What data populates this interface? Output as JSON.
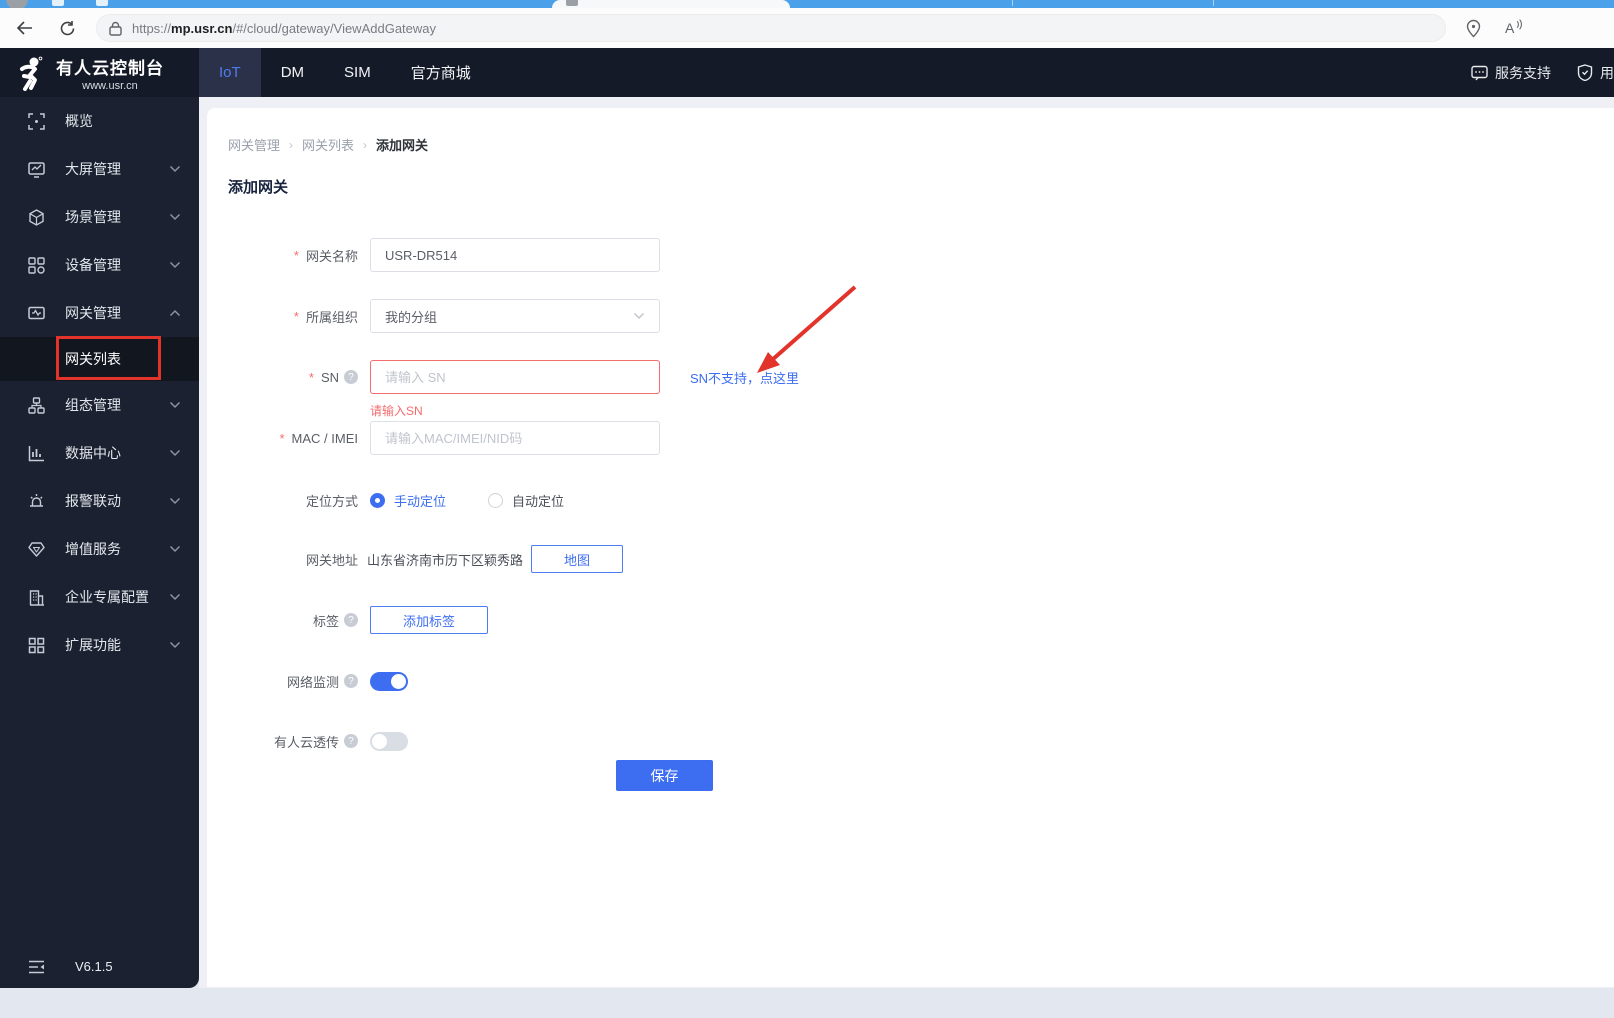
{
  "browser": {
    "url_prefix": "https://",
    "url_domain": "mp.usr.cn",
    "url_path": "/#/cloud/gateway/ViewAddGateway"
  },
  "header": {
    "logo_title": "有人云控制台",
    "logo_subtitle": "www.usr.cn",
    "nav": [
      {
        "label": "IoT"
      },
      {
        "label": "DM"
      },
      {
        "label": "SIM"
      },
      {
        "label": "官方商城"
      }
    ],
    "support_label": "服务支持",
    "user_label": "用"
  },
  "sidebar": {
    "items": [
      {
        "label": "概览"
      },
      {
        "label": "大屏管理"
      },
      {
        "label": "场景管理"
      },
      {
        "label": "设备管理"
      },
      {
        "label": "网关管理"
      },
      {
        "label": "组态管理"
      },
      {
        "label": "数据中心"
      },
      {
        "label": "报警联动"
      },
      {
        "label": "增值服务"
      },
      {
        "label": "企业专属配置"
      },
      {
        "label": "扩展功能"
      }
    ],
    "submenu_active": "网关列表",
    "version": "V6.1.5"
  },
  "breadcrumb": {
    "0": "网关管理",
    "1": "网关列表",
    "2": "添加网关"
  },
  "page": {
    "title": "添加网关"
  },
  "form": {
    "gateway_name": {
      "label": "网关名称",
      "value": "USR-DR514"
    },
    "organization": {
      "label": "所属组织",
      "value": "我的分组"
    },
    "sn": {
      "label": "SN",
      "placeholder": "请输入 SN",
      "error": "请输入SN",
      "link": "SN不支持，点这里"
    },
    "mac": {
      "label": "MAC / IMEI",
      "placeholder": "请输入MAC/IMEI/NID码"
    },
    "location_mode": {
      "label": "定位方式",
      "options": {
        "0": "手动定位",
        "1": "自动定位"
      },
      "selected": "手动定位"
    },
    "address": {
      "label": "网关地址",
      "value": "山东省济南市历下区颖秀路",
      "map_button": "地图"
    },
    "tags": {
      "label": "标签",
      "add_button": "添加标签"
    },
    "network_monitor": {
      "label": "网络监测",
      "state": "on"
    },
    "cloud_passthrough": {
      "label": "有人云透传",
      "state": "off"
    },
    "save_button": "保存"
  },
  "colors": {
    "accent_blue": "#3D6EF2",
    "error_red": "#F56C6C",
    "annotation_red": "#E2342A",
    "header_dark": "#141A27",
    "sidebar_dark": "#1B2130"
  }
}
